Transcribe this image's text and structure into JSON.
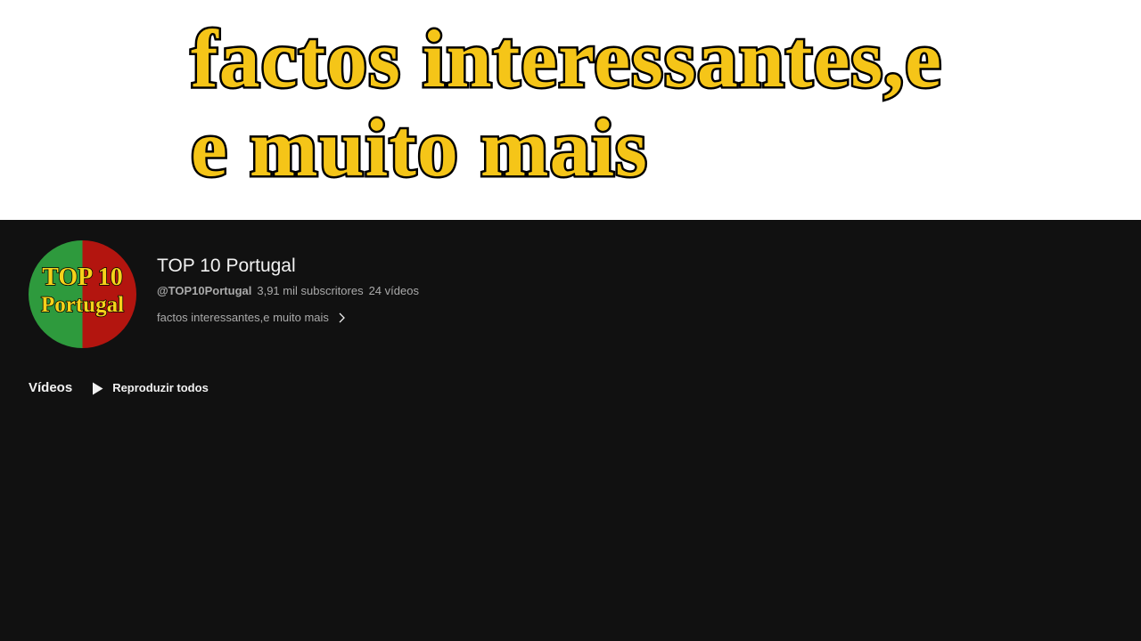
{
  "banner": {
    "line1": "factos interessantes,e",
    "line2": "e muito mais"
  },
  "channel": {
    "avatar": {
      "line1": "TOP 10",
      "line2": "Portugal"
    },
    "title": "TOP 10 Portugal",
    "handle": "@TOP10Portugal",
    "subscribers": "3,91 mil subscritores",
    "videos_count": "24 vídeos",
    "description": "factos interessantes,e muito mais"
  },
  "videos_section": {
    "title": "Vídeos",
    "play_all_label": "Reproduzir todos"
  },
  "icons": {
    "description_more": "chevron-right-icon",
    "play_all": "play-icon"
  },
  "colors": {
    "background": "#111111",
    "banner_background": "#ffffff",
    "banner_text": "#f5c518",
    "text_primary": "#f1f1f1",
    "text_secondary": "#aaaaaa",
    "avatar_green": "#2e9a3d",
    "avatar_red": "#b3150f"
  }
}
